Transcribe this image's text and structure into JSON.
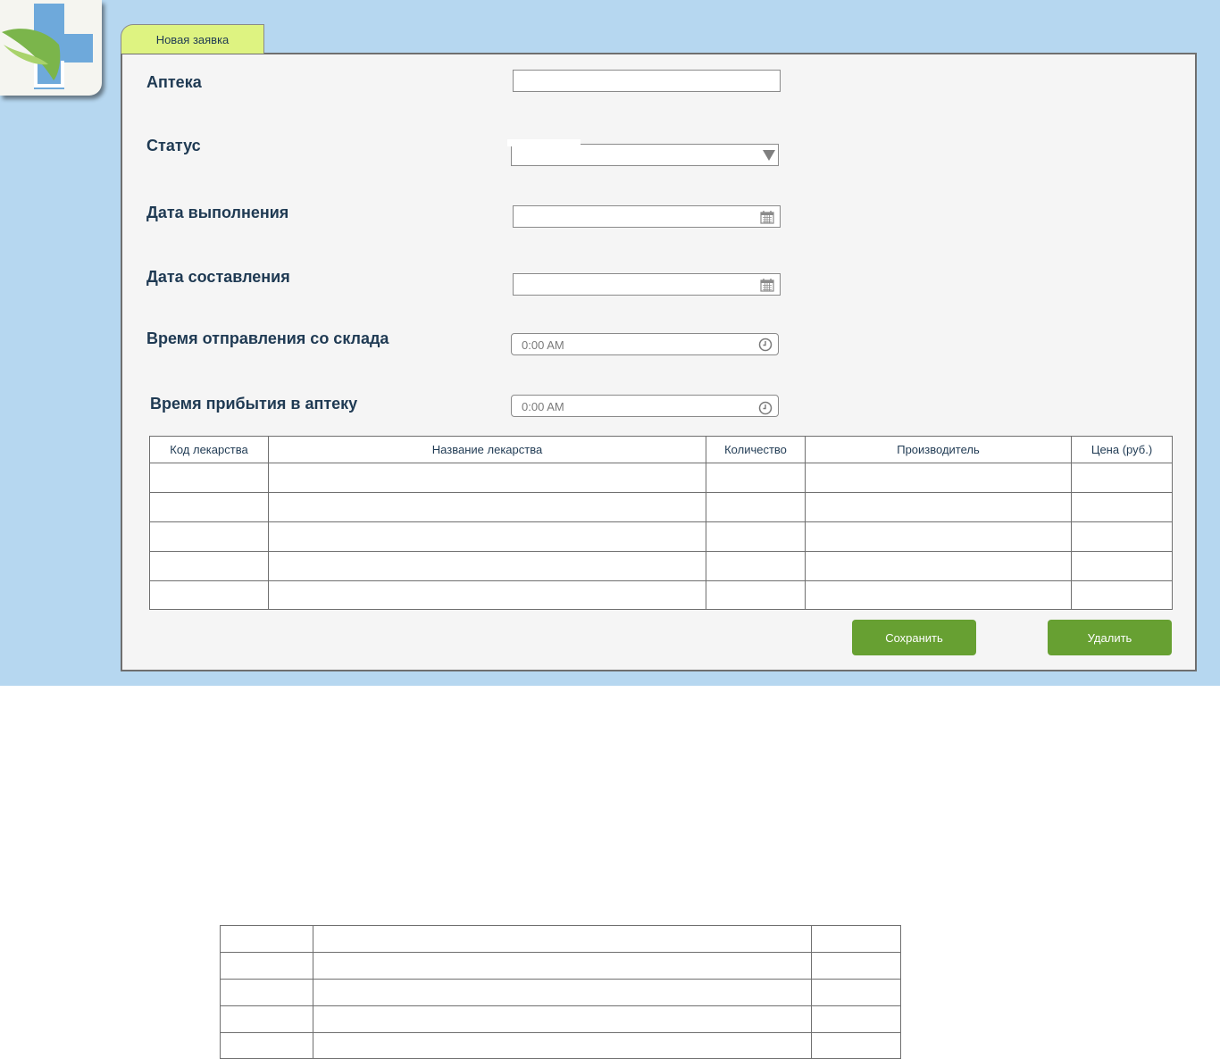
{
  "tab": {
    "label": "Новая заявка"
  },
  "form": {
    "pharmacy": {
      "label": "Аптека",
      "value": ""
    },
    "status": {
      "label": "Статус",
      "value": ""
    },
    "completion_date": {
      "label": "Дата выполнения",
      "value": ""
    },
    "creation_date": {
      "label": "Дата составления",
      "value": ""
    },
    "departure_time": {
      "label": "Время отправления со склада",
      "value": "0:00 AM"
    },
    "arrival_time": {
      "label": "Время прибытия в аптеку",
      "value": "0:00 AM"
    }
  },
  "table": {
    "columns": [
      "Код лекарства",
      "Название лекарства",
      "Количество",
      "Производитель",
      "Цена (руб.)"
    ],
    "empty_rows": 5
  },
  "buttons": {
    "save": "Сохранить",
    "delete": "Удалить"
  },
  "lower_table": {
    "columns": 3,
    "empty_rows": 5
  },
  "colors": {
    "background": "#b6d7f0",
    "tab": "#def381",
    "button": "#67a032",
    "label": "#1f3a53"
  },
  "icons": [
    "logo-icon",
    "calendar-icon",
    "clock-icon",
    "chevron-down-icon"
  ]
}
